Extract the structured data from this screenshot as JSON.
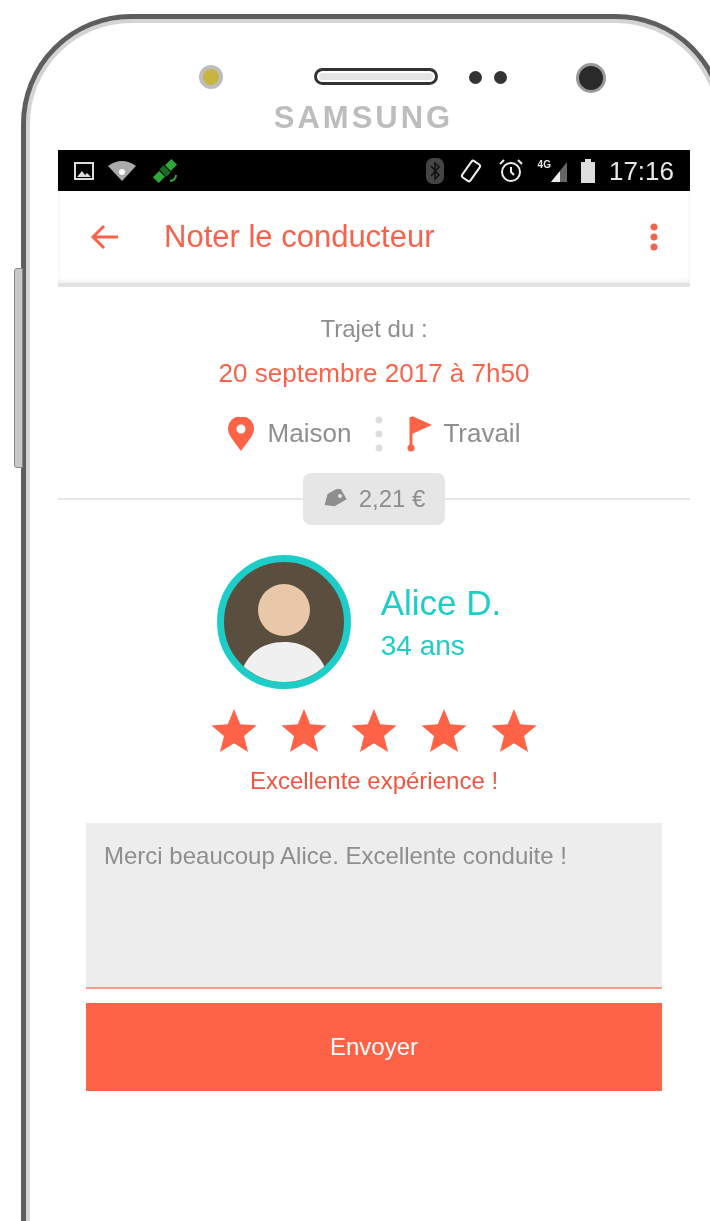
{
  "device": {
    "brand": "SAMSUNG"
  },
  "status_bar": {
    "network_type": "4G",
    "time": "17:16"
  },
  "app_bar": {
    "title": "Noter le conducteur"
  },
  "trip": {
    "label": "Trajet du :",
    "date": "20 septembre 2017 à 7h50",
    "origin": "Maison",
    "destination": "Travail",
    "price": "2,21 €"
  },
  "driver": {
    "name": "Alice D.",
    "age": "34 ans",
    "stars": 5,
    "rating_label": "Excellente expérience !"
  },
  "comment": {
    "value": "Merci beaucoup Alice. Excellente conduite !"
  },
  "submit": {
    "label": "Envoyer"
  }
}
